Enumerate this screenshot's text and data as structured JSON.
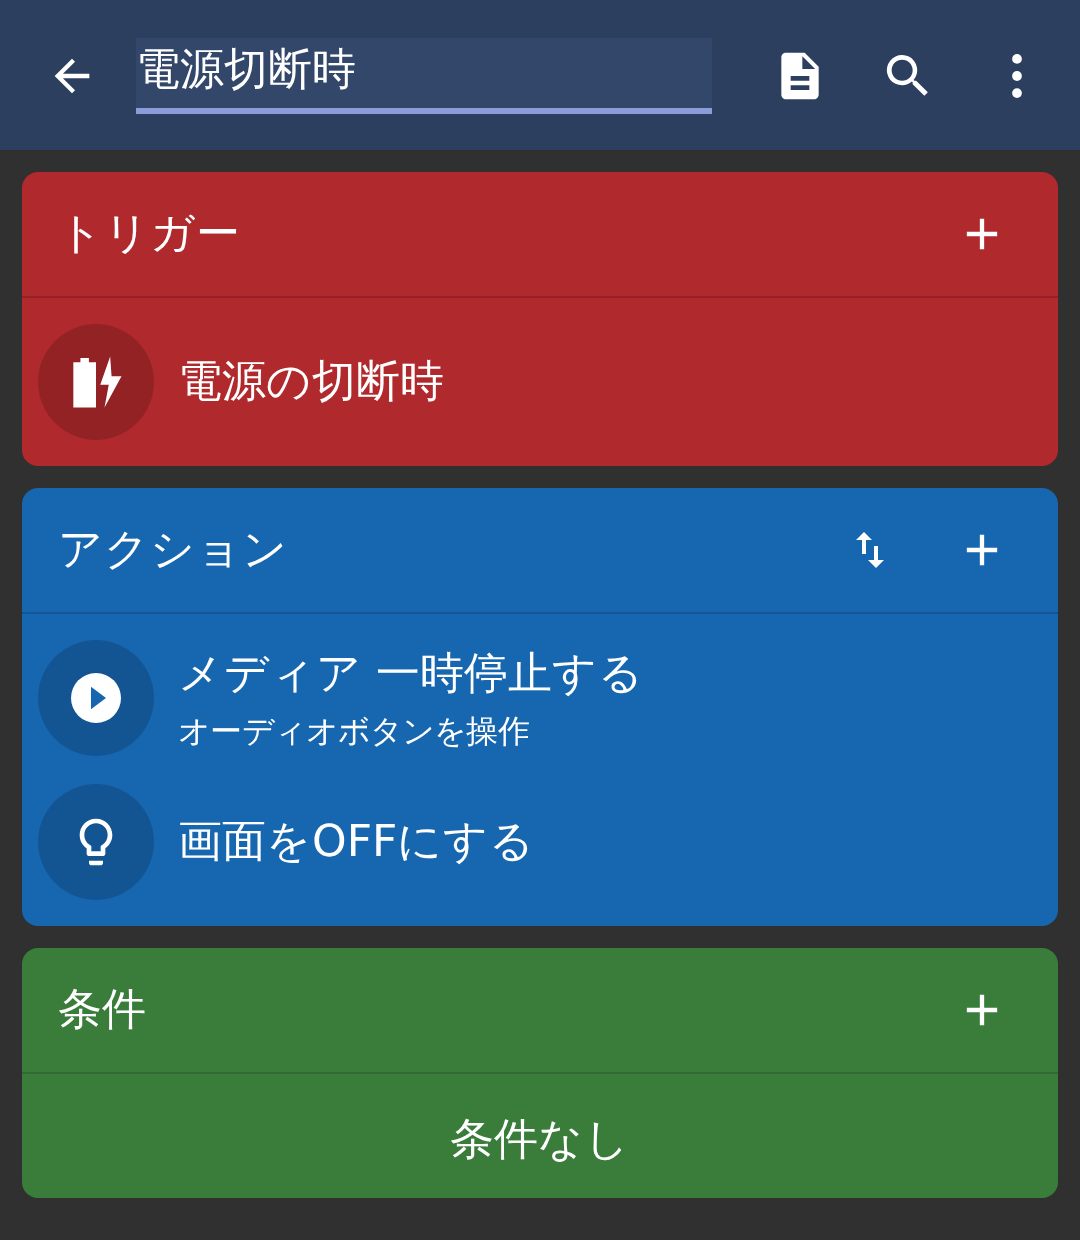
{
  "toolbar": {
    "title_field": "電源切断時"
  },
  "sections": [
    {
      "title": "トリガー",
      "color": "#b0292d",
      "reorderable": false,
      "items": [
        {
          "title": "電源の切断時"
        }
      ]
    },
    {
      "title": "アクション",
      "color": "#1766b0",
      "reorderable": true,
      "items": [
        {
          "title": "メディア 一時停止する",
          "subtitle": "オーディオボタンを操作"
        },
        {
          "title": "画面をOFFにする"
        }
      ]
    },
    {
      "title": "条件",
      "color": "#3a7d3b",
      "reorderable": false,
      "empty_text": "条件なし"
    }
  ]
}
